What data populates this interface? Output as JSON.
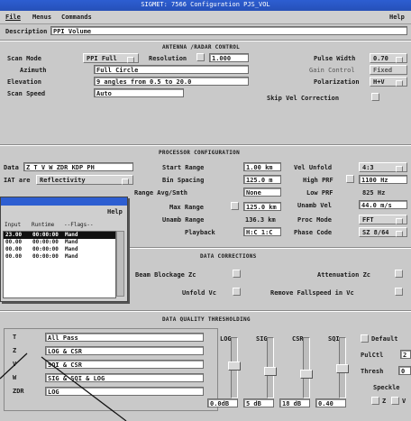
{
  "window": {
    "title": "SIGMET: 7566 Configuration PJS_VOL"
  },
  "menu": {
    "file": "File",
    "menus": "Menus",
    "commands": "Commands",
    "help": "Help"
  },
  "description": {
    "label": "Description",
    "value": "PPI Volume"
  },
  "antenna": {
    "heading": "ANTENNA /RADAR CONTROL",
    "scan_mode_label": "Scan Mode",
    "scan_mode_value": "PPI Full",
    "resolution_label": "Resolution",
    "resolution_value": "1.000",
    "azimuth_label": "Azimuth",
    "azimuth_value": "Full Circle",
    "elevation_label": "Elevation",
    "elevation_value": "9 angles from 0.5 to 20.0",
    "scan_speed_label": "Scan Speed",
    "scan_speed_value": "Auto",
    "pulse_width_label": "Pulse Width",
    "pulse_width_value": "0.70",
    "gain_control_label": "Gain Control",
    "gain_control_value": "Fixed",
    "polarization_label": "Polarization",
    "polarization_value": "H+V",
    "skip_vel_label": "Skip Vel Correction"
  },
  "processor": {
    "heading": "PROCESSOR CONFIGURATION",
    "data_label": "Data",
    "data_value": "Z T V W ZDR KDP PH",
    "ier_label": "IAT are",
    "ier_value": "Reflectivity",
    "start_range_label": "Start Range",
    "start_range_value": "1.00 km",
    "bin_spacing_label": "Bin Spacing",
    "bin_spacing_value": "125.0 m",
    "range_avg_label": "Range Avg/Smth",
    "range_avg_value": "None",
    "max_range_label": "Max Range",
    "max_range_value": "125.0 km",
    "unamb_range_label": "Unamb Range",
    "unamb_range_value": "136.3 km",
    "playback_label": "Playback",
    "playback_value": "H:C 1:C",
    "vel_unfold_label": "Vel Unfold",
    "vel_unfold_value": "4:3",
    "high_prf_label": "High PRF",
    "high_prf_value": "1100 Hz",
    "low_prf_label": "Low PRF",
    "low_prf_value": "825 Hz",
    "unamb_vel_label": "Unamb Vel",
    "unamb_vel_value": "44.0 m/s",
    "proc_mode_label": "Proc Mode",
    "proc_mode_value": "FFT",
    "phase_code_label": "Phase Code",
    "phase_code_value": "SZ 8/64"
  },
  "corrections": {
    "heading": "DATA CORRECTIONS",
    "beam_blockage": "Beam Blockage Zc",
    "attenuation": "Attenuation Zc",
    "unfold_vc": "Unfold Vc",
    "remove_fallspeed": "Remove Fallspeed in Vc"
  },
  "quality": {
    "heading": "DATA QUALITY THRESHOLDING",
    "rows": [
      {
        "key": "T",
        "value": "All Pass"
      },
      {
        "key": "Z",
        "value": "LOG & CSR"
      },
      {
        "key": "V",
        "value": "SQI & CSR"
      },
      {
        "key": "W",
        "value": "SIG & SQI & LOG"
      },
      {
        "key": "ZDR",
        "value": "LOG"
      }
    ],
    "sliders": [
      {
        "label": "LOG",
        "value": "0.0dB",
        "level": 0.55
      },
      {
        "label": "SIG",
        "value": "5 dB",
        "level": 0.45
      },
      {
        "label": "CSR",
        "value": "18 dB",
        "level": 0.4
      },
      {
        "label": "SQI",
        "value": "0.40",
        "level": 0.5
      }
    ],
    "default_label": "Default",
    "pulse_label": "PulCtl",
    "thresh_label": "Thresh",
    "speckle_label": "Speckle",
    "pulse_value": "2",
    "thresh_value": "0",
    "z_chk": "Z",
    "v_chk": "V"
  },
  "popup": {
    "help": "Help",
    "col1": "Input",
    "col2": "Runtime",
    "col3": "--Flags--",
    "rows": [
      {
        "a": "23.00",
        "b": "00:00:00",
        "c": "Mand"
      },
      {
        "a": "00.00",
        "b": "00:00:00",
        "c": "Mand"
      },
      {
        "a": "00.00",
        "b": "00:00:00",
        "c": "Mand"
      },
      {
        "a": "00.00",
        "b": "00:00:00",
        "c": "Mand"
      }
    ]
  }
}
